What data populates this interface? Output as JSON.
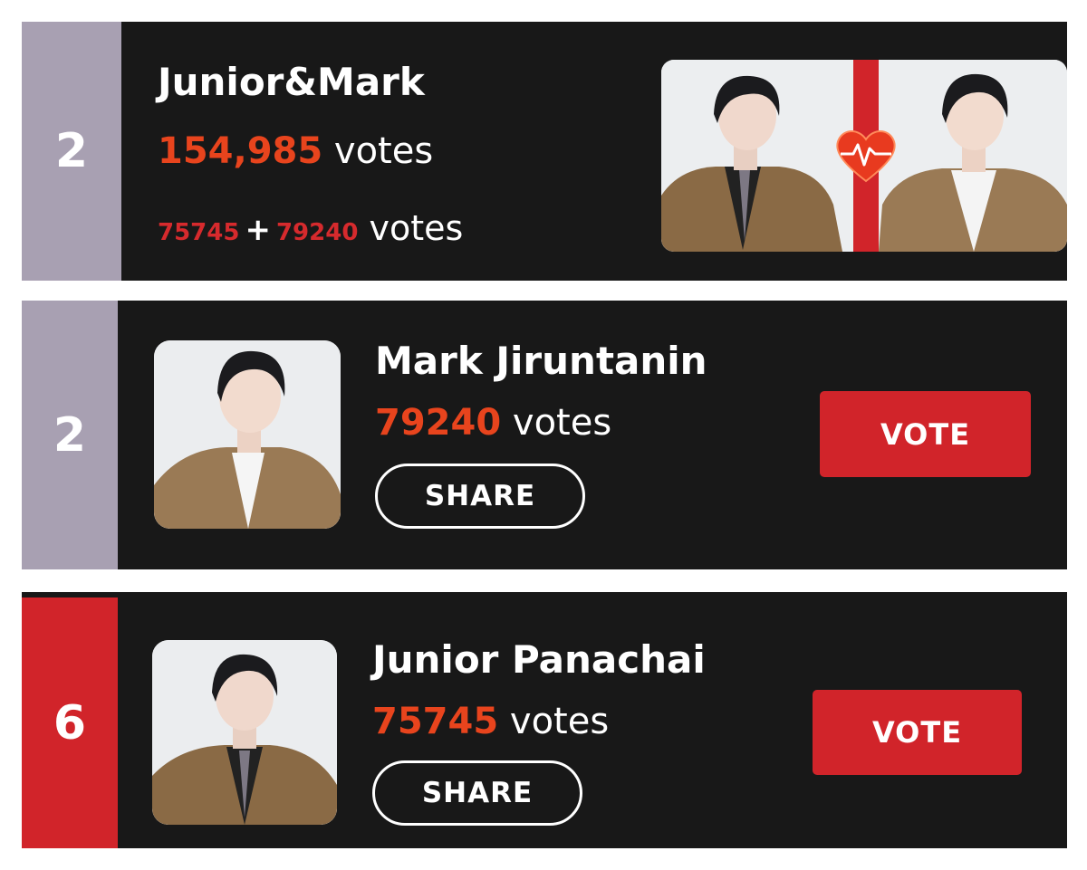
{
  "colors": {
    "card_bg": "#181818",
    "rank_lavender": "#a8a0b2",
    "rank_red": "#d1242a",
    "vote_number": "#e8441d",
    "vote_button": "#d1242a"
  },
  "cards": [
    {
      "rank": "2",
      "name": "Junior&Mark",
      "total_votes": "154,985",
      "votes_suffix": "votes",
      "part_a": "75745",
      "plus": "+",
      "part_b": "79240",
      "parts_suffix": "votes",
      "image": "duo-photo-with-heart-icon"
    },
    {
      "rank": "2",
      "name": "Mark Jiruntanin",
      "votes": "79240",
      "votes_suffix": "votes",
      "share_label": "SHARE",
      "vote_label": "VOTE",
      "image": "mark-portrait"
    },
    {
      "rank": "6",
      "name": "Junior Panachai",
      "votes": "75745",
      "votes_suffix": "votes",
      "share_label": "SHARE",
      "vote_label": "VOTE",
      "image": "junior-portrait"
    }
  ]
}
